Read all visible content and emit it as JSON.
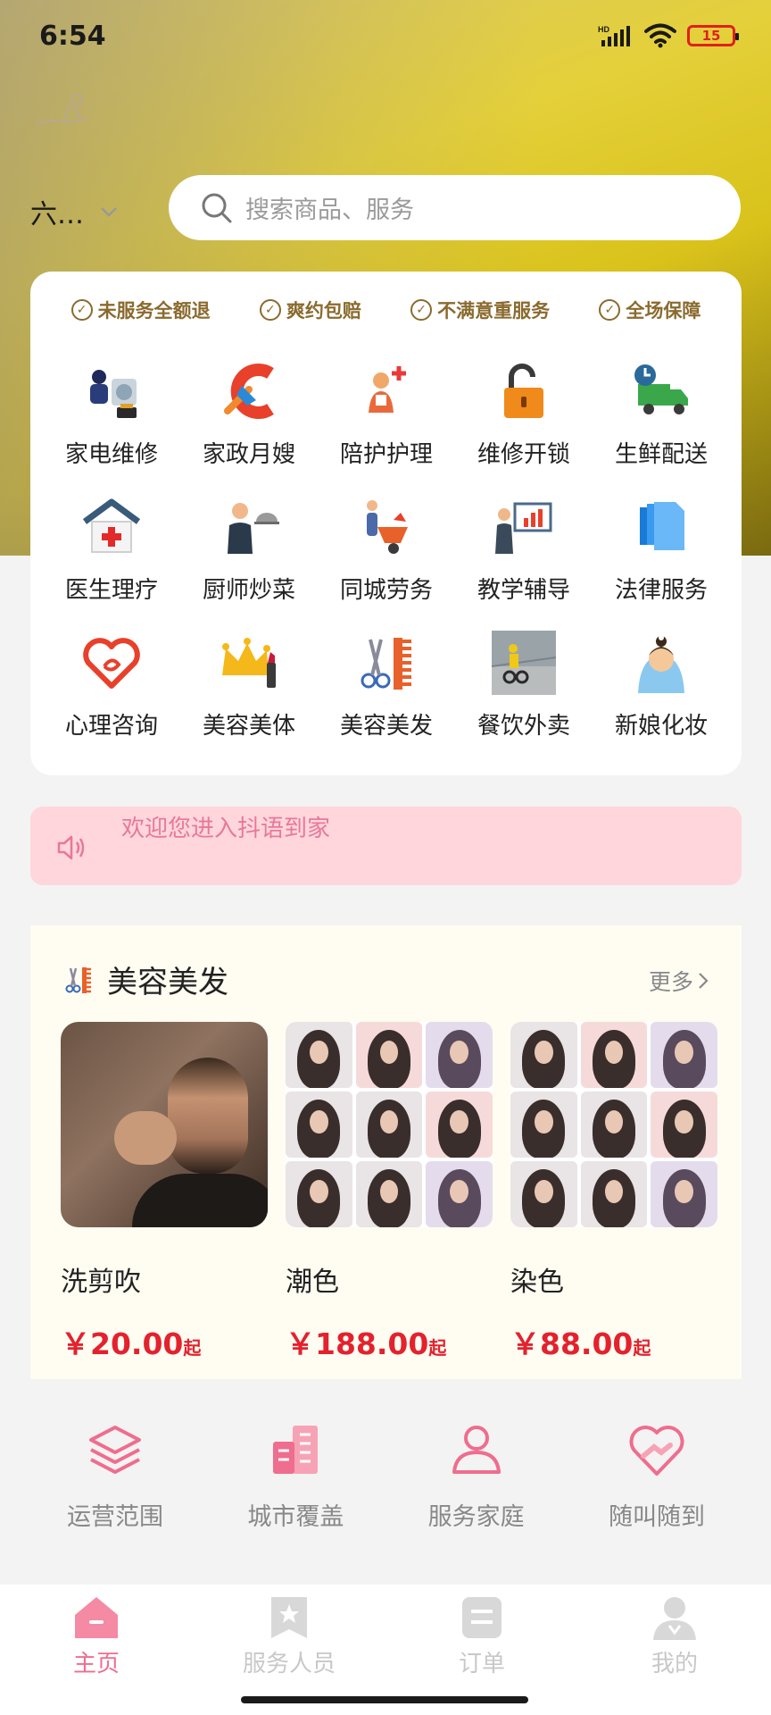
{
  "status_bar": {
    "time": "6:54",
    "battery": "15",
    "network": "HD"
  },
  "header": {
    "location": "六…",
    "search_placeholder": "搜索商品、服务"
  },
  "guarantees": [
    "未服务全额退",
    "爽约包赔",
    "不满意重服务",
    "全场保障"
  ],
  "services": [
    {
      "label": "家电维修",
      "icon": "appliance-repair-icon"
    },
    {
      "label": "家政月嫂",
      "icon": "housekeeping-icon"
    },
    {
      "label": "陪护护理",
      "icon": "nursing-icon"
    },
    {
      "label": "维修开锁",
      "icon": "unlock-icon"
    },
    {
      "label": "生鲜配送",
      "icon": "delivery-truck-icon"
    },
    {
      "label": "医生理疗",
      "icon": "clinic-icon"
    },
    {
      "label": "厨师炒菜",
      "icon": "chef-icon"
    },
    {
      "label": "同城劳务",
      "icon": "labor-wheelbarrow-icon"
    },
    {
      "label": "教学辅导",
      "icon": "teaching-board-icon"
    },
    {
      "label": "法律服务",
      "icon": "documents-icon"
    },
    {
      "label": "心理咨询",
      "icon": "heart-icon"
    },
    {
      "label": "美容美体",
      "icon": "crown-lipstick-icon"
    },
    {
      "label": "美容美发",
      "icon": "scissors-comb-icon"
    },
    {
      "label": "餐饮外卖",
      "icon": "food-delivery-photo"
    },
    {
      "label": "新娘化妆",
      "icon": "bride-icon"
    }
  ],
  "notice": {
    "text": "欢迎您进入抖语到家",
    "icon": "speaker-icon"
  },
  "beauty_section": {
    "title": "美容美发",
    "more": "更多",
    "products": [
      {
        "name": "洗剪吹",
        "price": "￥20.00",
        "suffix": "起"
      },
      {
        "name": "潮色",
        "price": "￥188.00",
        "suffix": "起"
      },
      {
        "name": "染色",
        "price": "￥88.00",
        "suffix": "起"
      }
    ]
  },
  "stats": [
    {
      "label": "运营范围",
      "icon": "layers-icon"
    },
    {
      "label": "城市覆盖",
      "icon": "buildings-icon"
    },
    {
      "label": "服务家庭",
      "icon": "user-icon"
    },
    {
      "label": "随叫随到",
      "icon": "heart-hand-icon"
    }
  ],
  "tabs": [
    {
      "label": "主页",
      "active": true
    },
    {
      "label": "服务人员",
      "active": false
    },
    {
      "label": "订单",
      "active": false
    },
    {
      "label": "我的",
      "active": false
    }
  ],
  "colors": {
    "accent_pink": "#ef6d8e",
    "price_red": "#e3222e",
    "guarantee_brown": "#8a6a2e",
    "notice_bg": "#ffd6dc"
  }
}
